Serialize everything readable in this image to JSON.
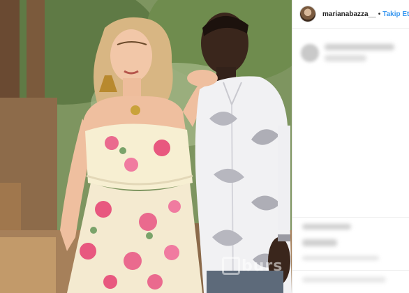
{
  "post": {
    "username": "marianabazza__",
    "separator": "•",
    "follow_label": "Takip Et",
    "avatar_icon": "profile-avatar"
  },
  "photo": {
    "watermark_text": "burs"
  },
  "colors": {
    "follow_blue": "#3897f0",
    "username_text": "#262626"
  }
}
